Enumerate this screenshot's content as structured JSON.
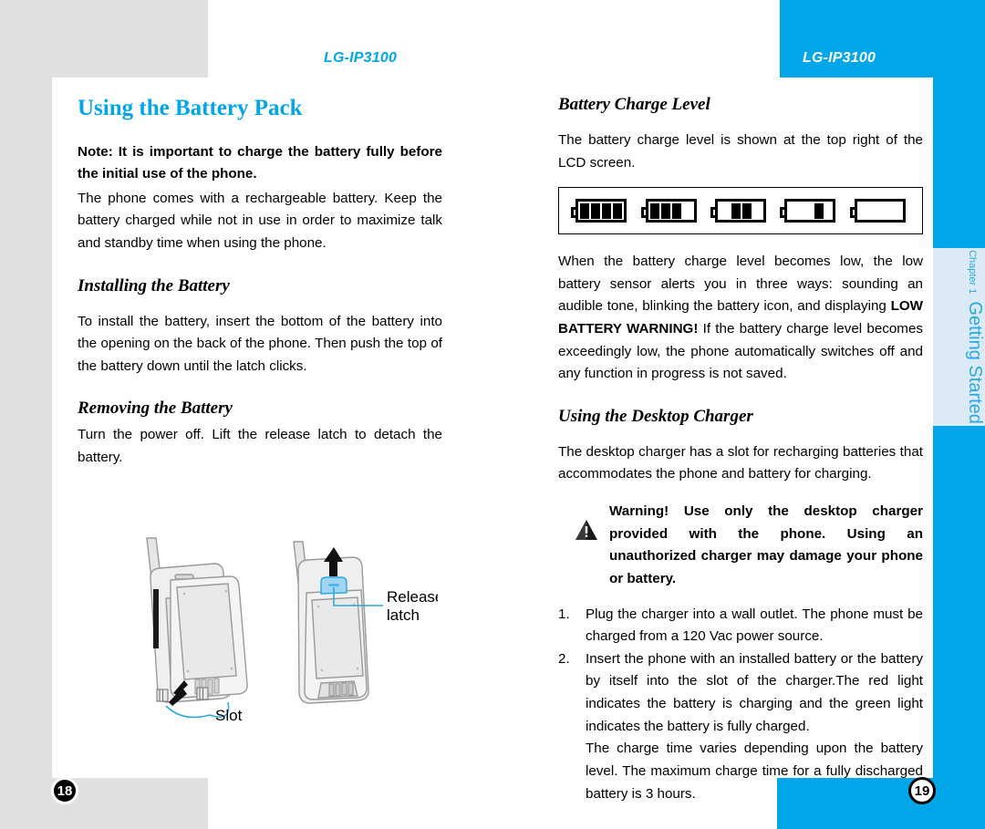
{
  "header": {
    "model_left": "LG-IP3100",
    "model_right": "LG-IP3100"
  },
  "sidebar": {
    "chapter": "Chapter 1",
    "title": "Getting Started"
  },
  "left_page": {
    "section_title": "Using the Battery Pack",
    "note": "Note: It is important to charge the battery fully before the initial use of the phone.",
    "intro": "The phone comes with a rechargeable battery. Keep the battery charged while not in use in order to maximize talk and standby time when using the phone.",
    "installing_title": "Installing the Battery",
    "installing_body": "To install the battery, insert the bottom of the battery into the opening on the back of the phone. Then push the top of the battery down until the latch clicks.",
    "removing_title": "Removing the Battery",
    "removing_body": "Turn the power off. Lift the release latch to detach the battery.",
    "illustration": {
      "label_release_latch_line1": "Release",
      "label_release_latch_line2": "latch",
      "label_slot": "Slot"
    },
    "page_number": "18"
  },
  "right_page": {
    "charge_level_title": "Battery Charge Level",
    "charge_level_body": "The battery charge level is shown at the top right of the LCD screen.",
    "battery_icons": [
      {
        "name": "battery-full-4-bars",
        "bars": 4
      },
      {
        "name": "battery-3-bars",
        "bars": 3
      },
      {
        "name": "battery-2-bars",
        "bars": 2
      },
      {
        "name": "battery-1-bar",
        "bars": 1
      },
      {
        "name": "battery-empty",
        "bars": 0
      }
    ],
    "low_battery_part1": "When the battery charge level becomes low, the low battery sensor alerts you in three ways: sounding an audible tone, blinking the battery icon, and displaying ",
    "low_battery_bold": "LOW BATTERY WARNING!",
    "low_battery_part2": " If the battery charge level becomes exceedingly low, the phone automatically switches off and any function in progress is not saved.",
    "desktop_charger_title": "Using the Desktop Charger",
    "desktop_charger_body": "The desktop charger has a slot for recharging batteries that accommodates the phone and battery for charging.",
    "warning": "Warning! Use only the desktop charger provided with the phone. Using an unauthorized charger may damage your phone or battery.",
    "steps": [
      "Plug the charger into a wall outlet. The phone must be charged from a 120 Vac power source.",
      "Insert the phone with an installed battery or the battery by itself into the slot of the charger.The red light indicates the battery is charging and the green light indicates the battery is fully charged."
    ],
    "step_continuation": "The charge time varies depending upon the battery level. The maximum charge time for a fully discharged battery is 3 hours.",
    "page_number": "19"
  },
  "colors": {
    "accent_cyan": "#00a6e8",
    "sidebar_tab": "#dceaf8",
    "gray_block": "#e0e0e0",
    "sidebar_text": "#29a9e1"
  }
}
